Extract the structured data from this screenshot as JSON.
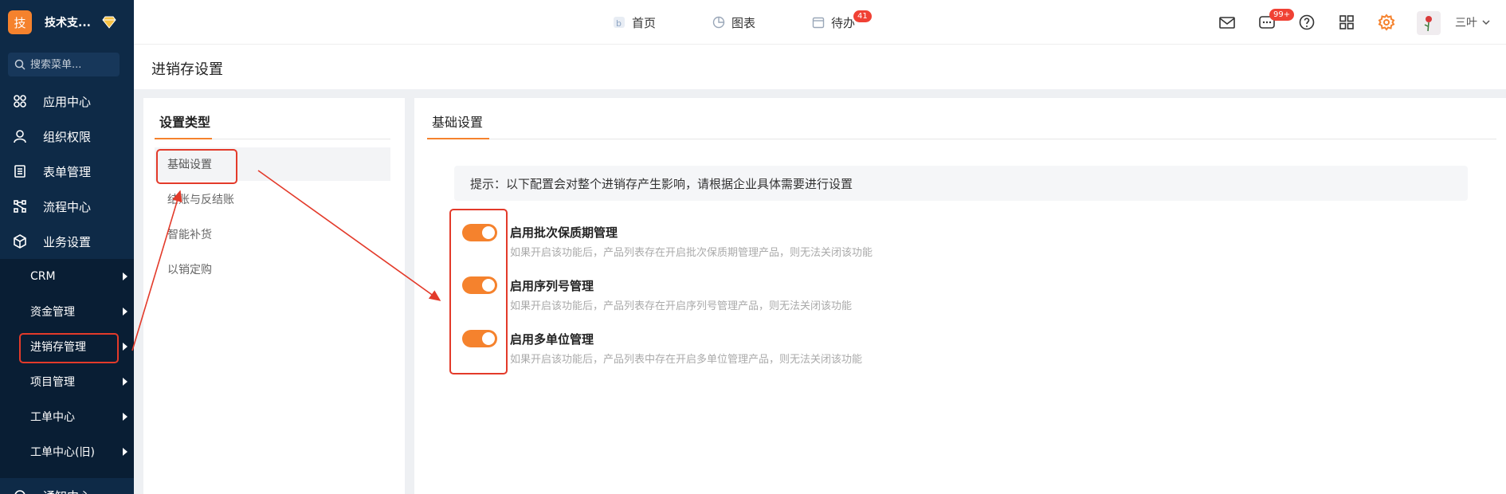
{
  "sidebar": {
    "brand_logo": "技",
    "brand_name": "技术支...",
    "search_placeholder": "搜索菜单...",
    "nav_items": [
      {
        "label": "应用中心",
        "icon": "apps-icon"
      },
      {
        "label": "组织权限",
        "icon": "user-icon"
      },
      {
        "label": "表单管理",
        "icon": "form-icon"
      },
      {
        "label": "流程中心",
        "icon": "flow-icon"
      },
      {
        "label": "业务设置",
        "icon": "cube-icon"
      }
    ],
    "sub_items": [
      {
        "label": "CRM"
      },
      {
        "label": "资金管理"
      },
      {
        "label": "进销存管理"
      },
      {
        "label": "项目管理"
      },
      {
        "label": "工单中心"
      },
      {
        "label": "工单中心(旧)"
      }
    ],
    "cut_item": "通知中心"
  },
  "topbar": {
    "nav": [
      {
        "label": "首页",
        "icon": "home-icon"
      },
      {
        "label": "图表",
        "icon": "chart-icon"
      },
      {
        "label": "待办",
        "icon": "calendar-icon",
        "badge": "41"
      }
    ],
    "message_badge": "99+",
    "username": "三叶"
  },
  "page": {
    "title": "进销存设置"
  },
  "settings_types": {
    "heading": "设置类型",
    "items": [
      "基础设置",
      "结账与反结账",
      "智能补货",
      "以销定购"
    ],
    "active": "基础设置"
  },
  "basic": {
    "heading": "基础设置",
    "notice": "提示：以下配置会对整个进销存产生影响，请根据企业具体需要进行设置",
    "options": [
      {
        "title": "启用批次保质期管理",
        "desc": "如果开启该功能后，产品列表存在开启批次保质期管理产品，则无法关闭该功能",
        "enabled": true
      },
      {
        "title": "启用序列号管理",
        "desc": "如果开启该功能后，产品列表存在开启序列号管理产品，则无法关闭该功能",
        "enabled": true
      },
      {
        "title": "启用多单位管理",
        "desc": "如果开启该功能后，产品列表中存在开启多单位管理产品，则无法关闭该功能",
        "enabled": true
      }
    ]
  },
  "colors": {
    "accent": "#f5822d",
    "annotation": "#e33a2a",
    "sidebar_bg": "#0e2a47"
  }
}
